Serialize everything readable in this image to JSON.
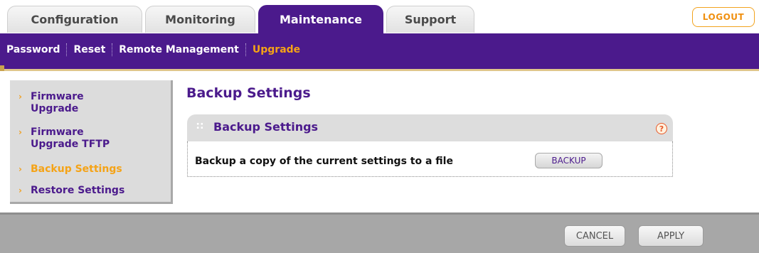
{
  "tabs": [
    {
      "label": "Configuration",
      "active": false
    },
    {
      "label": "Monitoring",
      "active": false
    },
    {
      "label": "Maintenance",
      "active": true
    },
    {
      "label": "Support",
      "active": false
    }
  ],
  "logout_label": "LOGOUT",
  "subnav": {
    "items": [
      "Password",
      "Reset",
      "Remote Management",
      "Upgrade"
    ],
    "active": "Upgrade"
  },
  "sidebar": {
    "items": [
      {
        "lines": [
          "Firmware",
          "Upgrade"
        ],
        "current": false
      },
      {
        "lines": [
          "Firmware",
          "Upgrade TFTP"
        ],
        "current": false
      },
      {
        "lines": [
          "Backup Settings"
        ],
        "current": true
      },
      {
        "lines": [
          "Restore Settings"
        ],
        "current": false
      }
    ]
  },
  "main": {
    "page_title": "Backup Settings",
    "panel_title": "Backup Settings",
    "help_symbol": "?",
    "description": "Backup a copy of the current settings to a file",
    "backup_label": "BACKUP"
  },
  "footer": {
    "cancel_label": "CANCEL",
    "apply_label": "APPLY"
  },
  "colors": {
    "brand_purple": "#4b1a8c",
    "accent_orange": "#f5a316"
  }
}
